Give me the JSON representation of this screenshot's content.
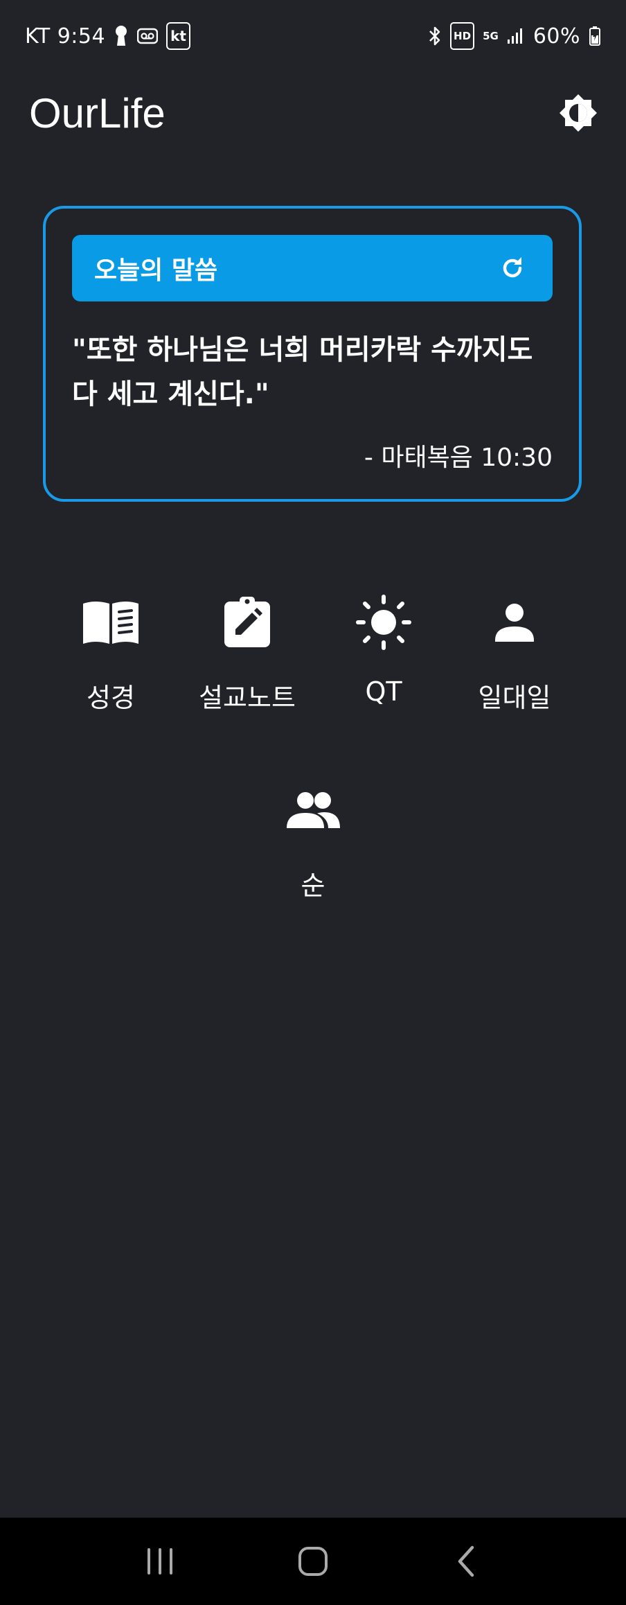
{
  "status_bar": {
    "carrier_time": "KT 9:54",
    "kt_badge": "kt",
    "hd_badge": "HD",
    "network": "5G",
    "battery": "60%"
  },
  "app_bar": {
    "title": "OurLife"
  },
  "word_card": {
    "header": "오늘의 말씀",
    "verse": "\"또한 하나님은 너희 머리카락 수까지도 다 세고 계신다.\"",
    "reference": "- 마태복음 10:30"
  },
  "menu": {
    "bible": "성경",
    "sermon_note": "설교노트",
    "qt": "QT",
    "one_on_one": "일대일",
    "soon": "순"
  },
  "colors": {
    "background": "#212329",
    "accent": "#0a9be6",
    "card_border": "#1a9ae6",
    "nav_bar": "#000000"
  },
  "icons": {
    "theme_toggle": "brightness-icon",
    "refresh": "refresh-icon",
    "bible": "book-icon",
    "sermon_note": "clipboard-edit-icon",
    "qt": "sun-icon",
    "one_on_one": "person-icon",
    "soon": "people-icon"
  }
}
